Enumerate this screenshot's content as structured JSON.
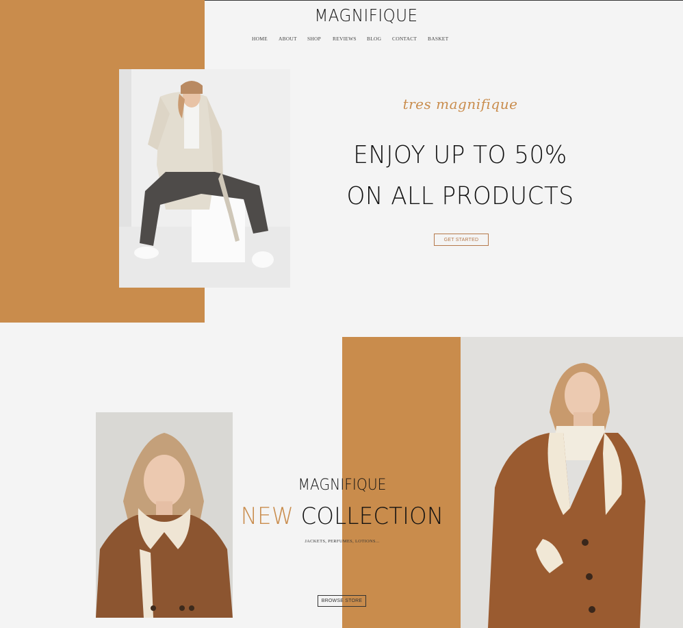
{
  "brand": {
    "logo": "MAGNIFIQUE"
  },
  "nav": {
    "items": [
      "HOME",
      "ABOUT",
      "SHOP",
      "REVIEWS",
      "BLOG",
      "CONTACT",
      "BASKET"
    ]
  },
  "hero": {
    "script": "tres magnifique",
    "headline_line1": "ENJOY UP TO 50%",
    "headline_line2": "ON ALL PRODUCTS",
    "button": "GET STARTED"
  },
  "collection": {
    "logo": "MAGNIFIQUE",
    "title_accent": "NEW",
    "title_rest": "COLLECTION",
    "subtitle": "JACKETS, PERFUMES, LOTIONS...",
    "button": "BROWSE STORE"
  },
  "colors": {
    "accent": "#c98c4c",
    "background": "#f4f4f4",
    "text": "#111111"
  }
}
